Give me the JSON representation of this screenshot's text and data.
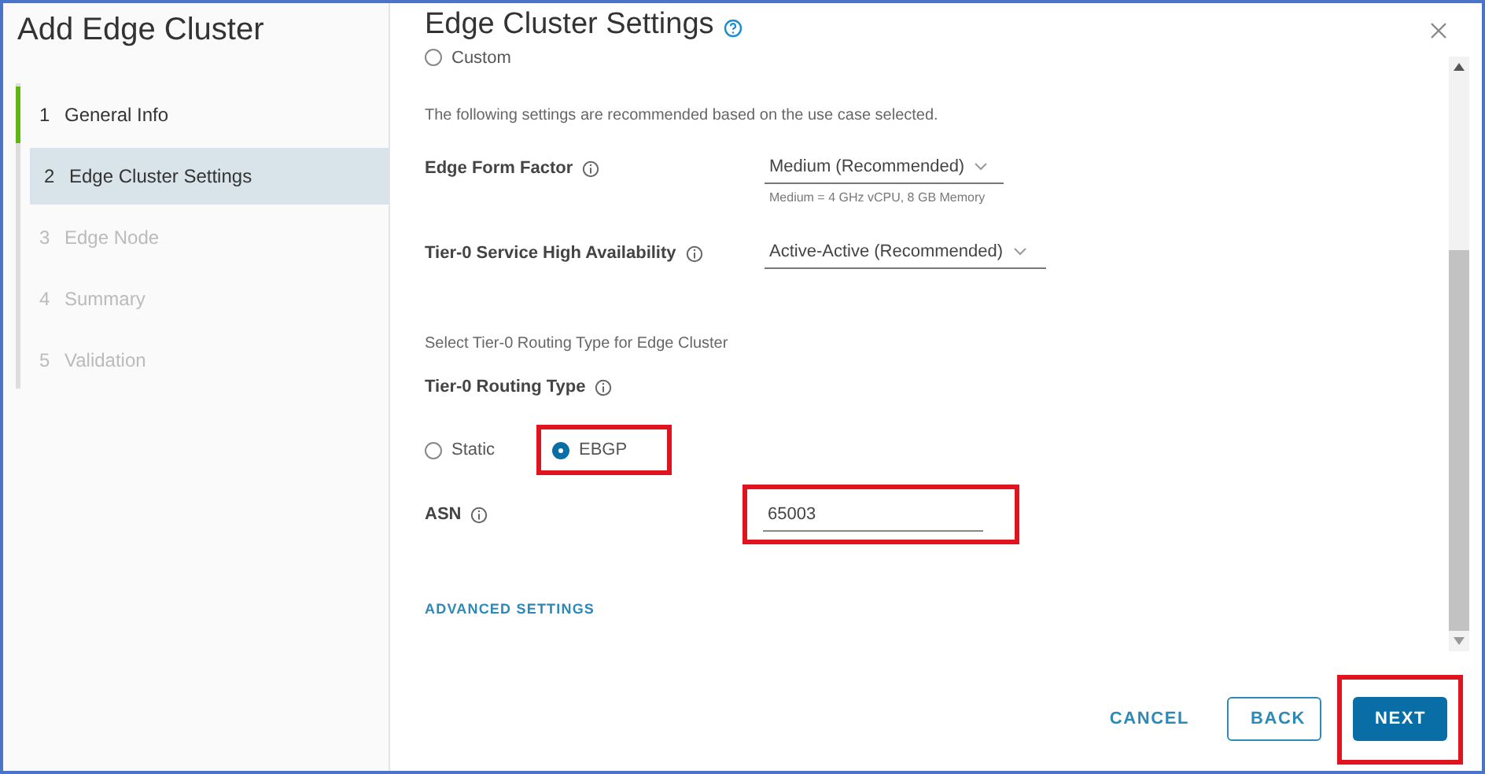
{
  "sidebar": {
    "title": "Add Edge Cluster",
    "steps": [
      {
        "number": "1",
        "label": "General Info",
        "completed": true,
        "disabled": false,
        "selected": false
      },
      {
        "number": "2",
        "label": "Edge Cluster Settings",
        "completed": false,
        "disabled": false,
        "selected": true
      },
      {
        "number": "3",
        "label": "Edge Node",
        "completed": false,
        "disabled": true,
        "selected": false
      },
      {
        "number": "4",
        "label": "Summary",
        "completed": false,
        "disabled": true,
        "selected": false
      },
      {
        "number": "5",
        "label": "Validation",
        "completed": false,
        "disabled": true,
        "selected": false
      }
    ]
  },
  "main": {
    "title": "Edge Cluster Settings",
    "top_radio": {
      "label": "Custom",
      "checked": false
    },
    "description": "The following settings are recommended based on the use case selected.",
    "form_factor": {
      "label": "Edge Form Factor",
      "value": "Medium (Recommended)",
      "hint": "Medium = 4 GHz vCPU, 8 GB Memory"
    },
    "high_availability": {
      "label": "Tier-0 Service High Availability",
      "value": "Active-Active (Recommended)"
    },
    "routing_note": "Select Tier-0 Routing Type for Edge Cluster",
    "routing_type": {
      "label": "Tier-0 Routing Type",
      "options": [
        {
          "label": "Static",
          "selected": false,
          "highlighted": false
        },
        {
          "label": "EBGP",
          "selected": true,
          "highlighted": true
        }
      ]
    },
    "asn": {
      "label": "ASN",
      "value": "65003",
      "highlighted": true
    },
    "advanced_link": "ADVANCED SETTINGS"
  },
  "footer": {
    "buttons": [
      {
        "label": "CANCEL",
        "kind": "flat",
        "highlighted": false
      },
      {
        "label": "BACK",
        "kind": "outline",
        "highlighted": false
      },
      {
        "label": "NEXT",
        "kind": "primary",
        "highlighted": true
      }
    ]
  }
}
